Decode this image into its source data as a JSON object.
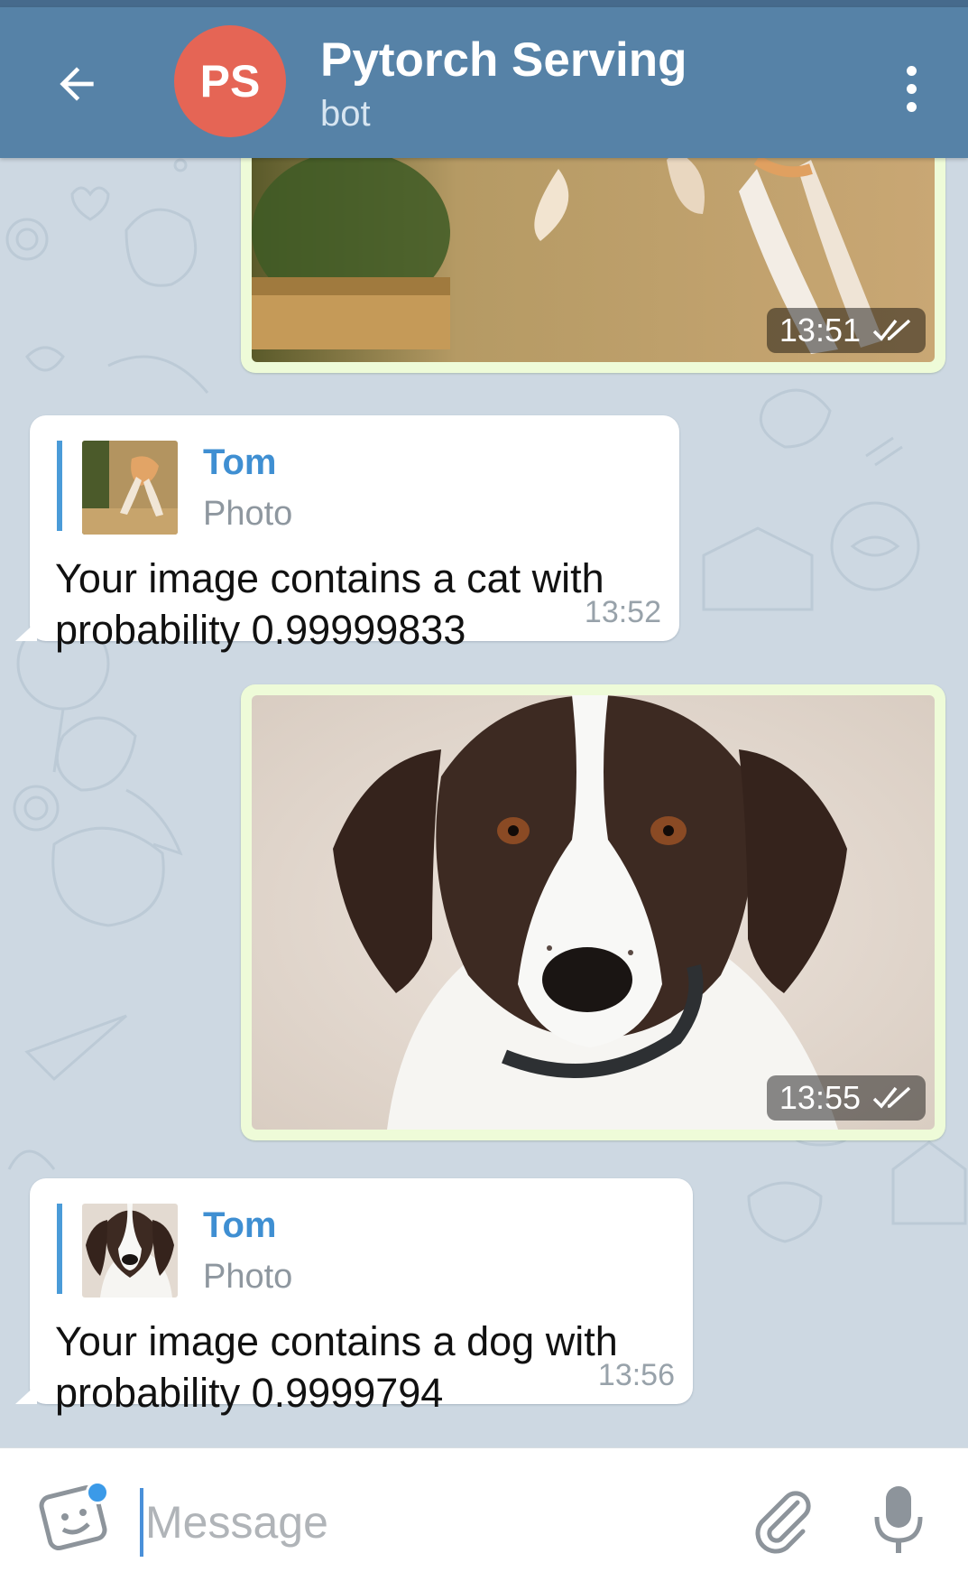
{
  "header": {
    "avatar_initials": "PS",
    "title": "Pytorch Serving",
    "subtitle": "bot"
  },
  "messages": [
    {
      "kind": "outgoing-photo",
      "subject": "cat",
      "time": "13:51",
      "status": "read"
    },
    {
      "kind": "incoming-reply",
      "quote_name": "Tom",
      "quote_type": "Photo",
      "text_line1": "Your image contains a cat with",
      "text_line2": "probability 0.99999833",
      "time": "13:52"
    },
    {
      "kind": "outgoing-photo",
      "subject": "dog",
      "time": "13:55",
      "status": "read"
    },
    {
      "kind": "incoming-reply",
      "quote_name": "Tom",
      "quote_type": "Photo",
      "text_line1": "Your image contains a dog with",
      "text_line2": "probability 0.9999794",
      "time": "13:56"
    }
  ],
  "input": {
    "placeholder": "Message",
    "value": ""
  },
  "colors": {
    "header": "#5682a7",
    "outgoing_bubble": "#eefbd8",
    "quote_accent": "#4a9bd8",
    "avatar": "#e56555"
  },
  "icons": [
    "back-arrow-icon",
    "more-vertical-icon",
    "double-check-icon",
    "sticker-icon",
    "paperclip-icon",
    "microphone-icon"
  ]
}
